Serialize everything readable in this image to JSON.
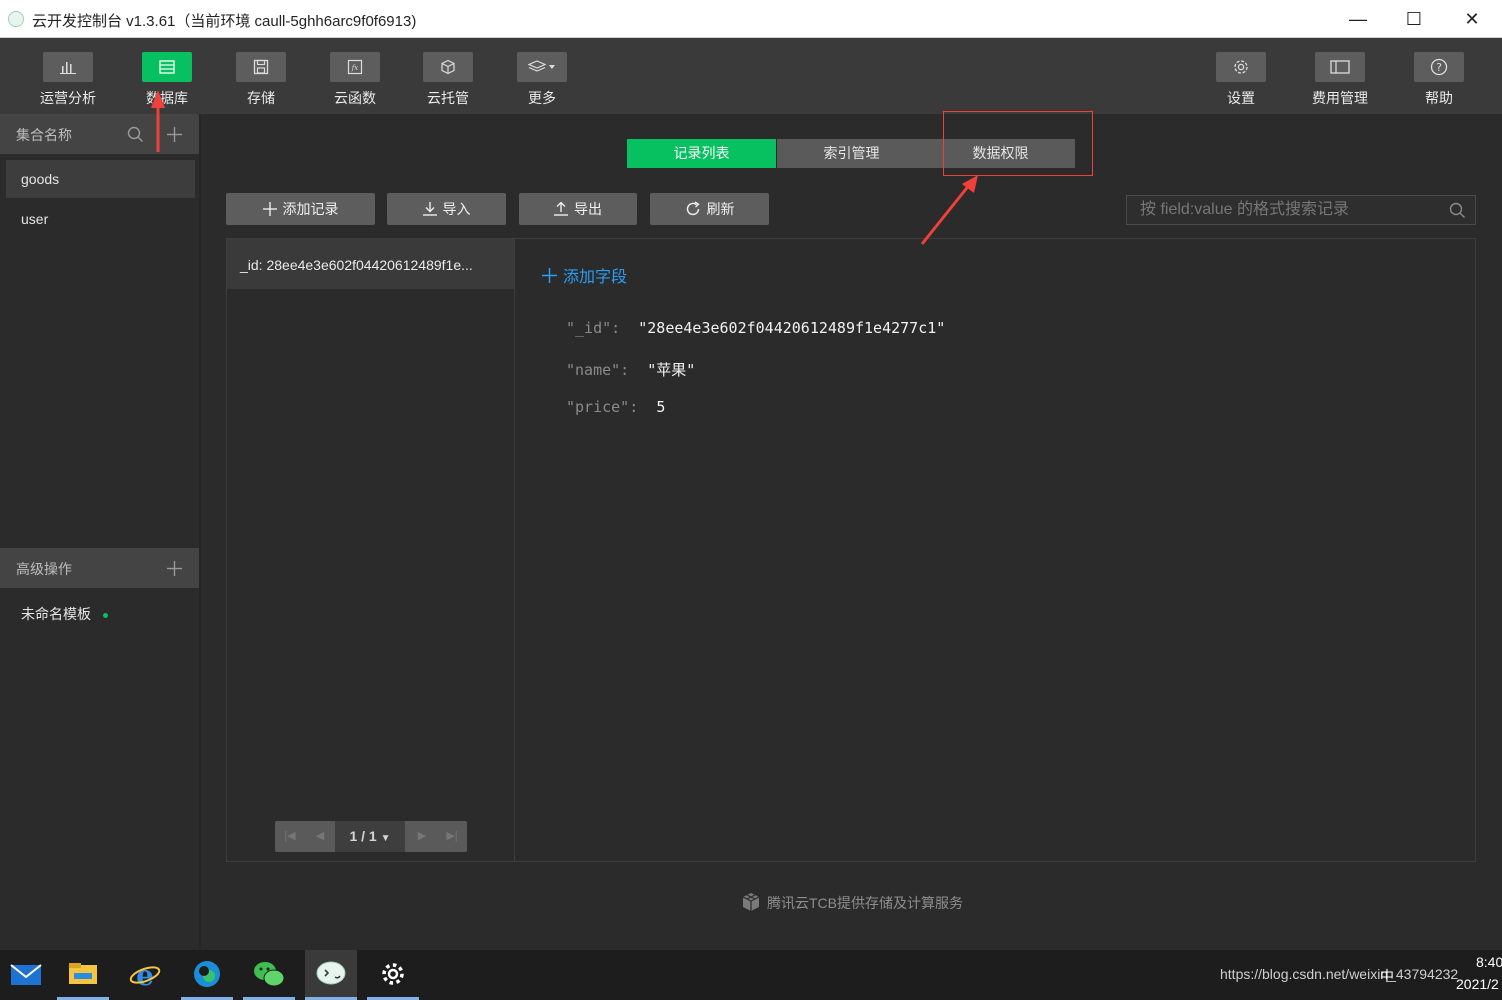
{
  "window": {
    "title": "云开发控制台 v1.3.61（当前环境 caull-5ghh6arc9f0f6913)",
    "controls": {
      "minimize": "—",
      "maximize": "☐",
      "close": "✕"
    }
  },
  "toolbar": {
    "left": [
      {
        "label": "运营分析",
        "icon": "bar-chart-icon",
        "active": false
      },
      {
        "label": "数据库",
        "icon": "database-icon",
        "active": true
      },
      {
        "label": "存储",
        "icon": "save-icon",
        "active": false
      },
      {
        "label": "云函数",
        "icon": "function-icon",
        "active": false
      },
      {
        "label": "云托管",
        "icon": "cube-icon",
        "active": false
      },
      {
        "label": "更多",
        "icon": "layers-icon",
        "active": false
      }
    ],
    "right": [
      {
        "label": "设置",
        "icon": "gear-icon"
      },
      {
        "label": "费用管理",
        "icon": "billing-icon"
      },
      {
        "label": "帮助",
        "icon": "help-icon"
      }
    ]
  },
  "sidebar": {
    "collections_header": "集合名称",
    "collections": [
      {
        "label": "goods",
        "active": true
      },
      {
        "label": "user",
        "active": false
      }
    ],
    "advanced_header": "高级操作",
    "templates": [
      {
        "label": "未命名模板"
      }
    ]
  },
  "tabs": [
    {
      "label": "记录列表",
      "active": true
    },
    {
      "label": "索引管理",
      "active": false
    },
    {
      "label": "数据权限",
      "active": false
    }
  ],
  "actions": {
    "add_record": "添加记录",
    "import": "导入",
    "export": "导出",
    "refresh": "刷新"
  },
  "search": {
    "placeholder": "按 field:value 的格式搜索记录"
  },
  "records": {
    "list": [
      "_id: 28ee4e3e602f04420612489f1e..."
    ],
    "pager": "1 / 1"
  },
  "document": {
    "add_field": "添加字段",
    "fields": [
      {
        "key": "\"_id\":",
        "value": "\"28ee4e3e602f04420612489f1e4277c1\""
      },
      {
        "key": "\"name\":",
        "value": "\"苹果\""
      },
      {
        "key": "\"price\":",
        "value": "5"
      }
    ]
  },
  "footer": "腾讯云TCB提供存储及计算服务",
  "taskbar": {
    "apps": [
      "mail-icon",
      "file-explorer-icon",
      "ie-icon",
      "edge-icon",
      "wechat-icon",
      "wechat-devtools-icon",
      "settings-icon"
    ],
    "tray_text": "https://blog.csdn.net/weixin_43794232",
    "ime": "中",
    "time": "8:40",
    "date": "2021/2"
  },
  "colors": {
    "accent": "#07c160",
    "annotation": "#f0403a",
    "link": "#2a9df4"
  }
}
